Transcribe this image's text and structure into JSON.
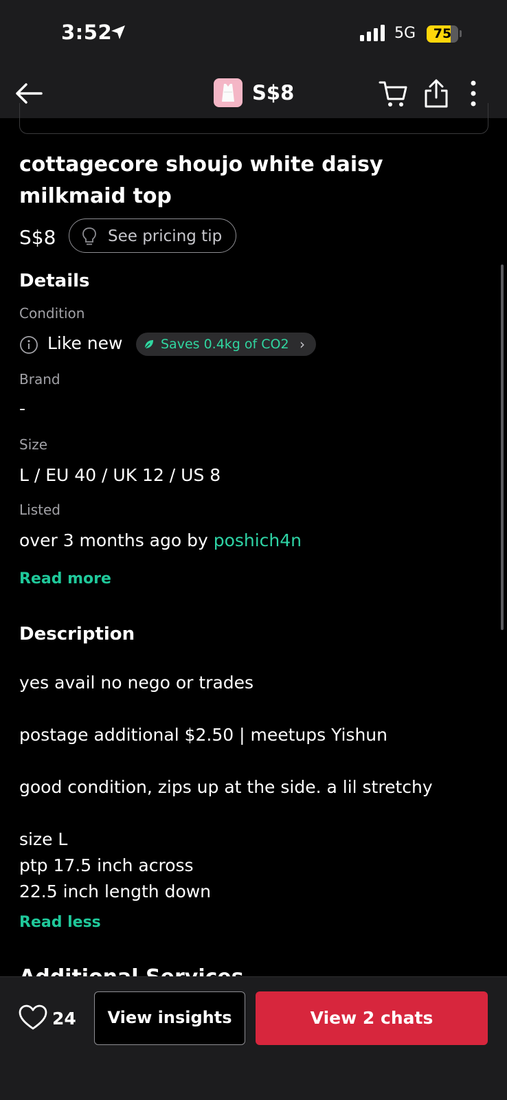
{
  "status_bar": {
    "time": "3:52",
    "network": "5G",
    "battery": "75",
    "battery_level_percent": 75
  },
  "nav": {
    "price": "S$8",
    "icons": [
      "back-arrow-icon",
      "cart-icon",
      "share-icon",
      "more-icon"
    ]
  },
  "listing": {
    "title": "cottagecore shoujo white daisy milkmaid top",
    "price": "S$8",
    "pricing_tip": "See pricing tip"
  },
  "details": {
    "heading": "Details",
    "condition_label": "Condition",
    "condition_value": "Like new",
    "co2_badge": "Saves 0.4kg of CO2",
    "brand_label": "Brand",
    "brand_value": "-",
    "size_label": "Size",
    "size_value": "L / EU 40 / UK 12 / US 8",
    "listed_label": "Listed",
    "listed_prefix": "over 3 months ago by ",
    "seller": "poshich4n",
    "read_more": "Read more"
  },
  "description": {
    "heading": "Description",
    "line1": "yes avail no nego or trades",
    "line2": "postage additional $2.50 | meetups Yishun",
    "line3": "good condition, zips up at the side. a lil stretchy",
    "line4": "size L",
    "line5": "ptp 17.5 inch across",
    "line6": "22.5 inch length down",
    "read_less": "Read less"
  },
  "next_section": "Additional Services",
  "bottom": {
    "likes": "24",
    "insights_button": "View insights",
    "chats_button": "View 2 chats"
  },
  "colors": {
    "accent_teal": "#1fc89a",
    "cta_red": "#d7263d",
    "battery_yellow": "#ffd60a"
  }
}
